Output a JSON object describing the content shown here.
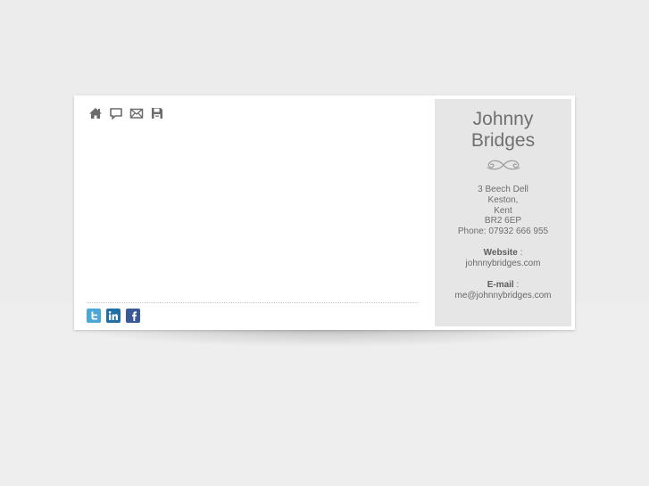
{
  "nav": {
    "icons": [
      "home-icon",
      "speech-bubble-icon",
      "mail-icon",
      "save-icon"
    ]
  },
  "social": {
    "icons": [
      "twitter-icon",
      "linkedin-icon",
      "facebook-icon"
    ],
    "colors": {
      "twitter": "#4aa7d7",
      "linkedin": "#1f6fa8",
      "facebook": "#3b5998"
    }
  },
  "contact": {
    "first_name": "Johnny",
    "last_name": "Bridges",
    "address": [
      "3 Beech Dell",
      "Keston,",
      "Kent",
      "BR2 6EP"
    ],
    "phone": "Phone: 07932 666 955",
    "website_label": "Website",
    "website_sep": " :",
    "website": "johnnybridges.com",
    "email_label": "E-mail",
    "email_sep": " :",
    "email": "me@johnnybridges.com"
  }
}
